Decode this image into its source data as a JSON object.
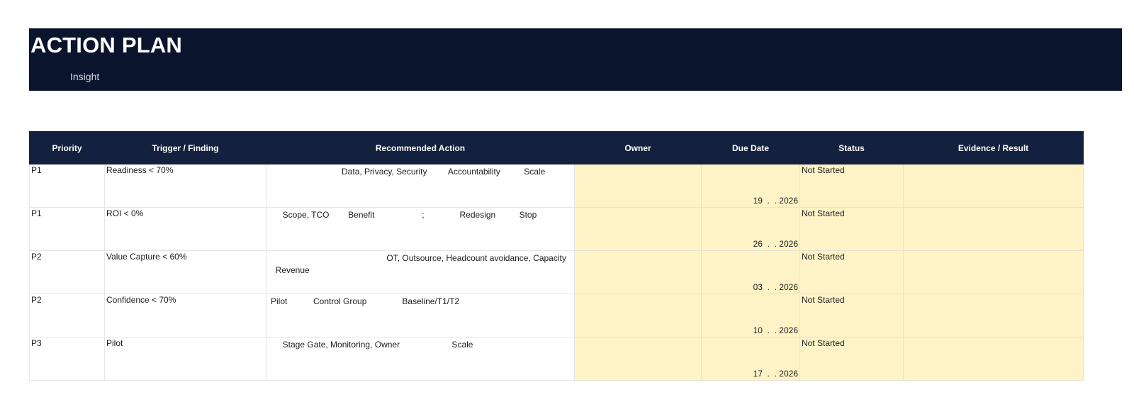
{
  "banner": {
    "title": "ACTION PLAN",
    "subtitle": "Insight"
  },
  "colors": {
    "banner_bg": "#0b142d",
    "header_bg": "#13213f",
    "fill": "#fdf3c7"
  },
  "table": {
    "headers": [
      "Priority",
      "Trigger / Finding",
      "Recommended Action",
      "Owner",
      "Due Date",
      "Status",
      "Evidence / Result"
    ],
    "rows": [
      {
        "priority": "P1",
        "trigger": "Readiness < 70%",
        "action_line1": "                              Data, Privacy, Security         Accountability          Scale",
        "action_line2": "",
        "owner": "",
        "due": "19  .  . 2026",
        "status": "Not Started",
        "evidence": ""
      },
      {
        "priority": "P1",
        "trigger": "ROI < 0%",
        "action_line1": "     Scope, TCO        Benefit                    ;               Redesign          Stop",
        "action_line2": "",
        "owner": "",
        "due": "26  .  . 2026",
        "status": "Not Started",
        "evidence": ""
      },
      {
        "priority": "P2",
        "trigger": "Value Capture < 60%",
        "action_line1": "                                                 OT, Outsource, Headcount avoidance, Capacity",
        "action_line2": "  Revenue",
        "owner": "",
        "due": "03  .  . 2026",
        "status": "Not Started",
        "evidence": ""
      },
      {
        "priority": "P2",
        "trigger": "Confidence < 70%",
        "action_line1": "Pilot           Control Group               Baseline/T1/T2",
        "action_line2": "",
        "owner": "",
        "due": "10  .  . 2026",
        "status": "Not Started",
        "evidence": ""
      },
      {
        "priority": "P3",
        "trigger": "Pilot",
        "action_line1": "     Stage Gate, Monitoring, Owner                      Scale",
        "action_line2": "",
        "owner": "",
        "due": "17  .  . 2026",
        "status": "Not Started",
        "evidence": ""
      }
    ]
  }
}
